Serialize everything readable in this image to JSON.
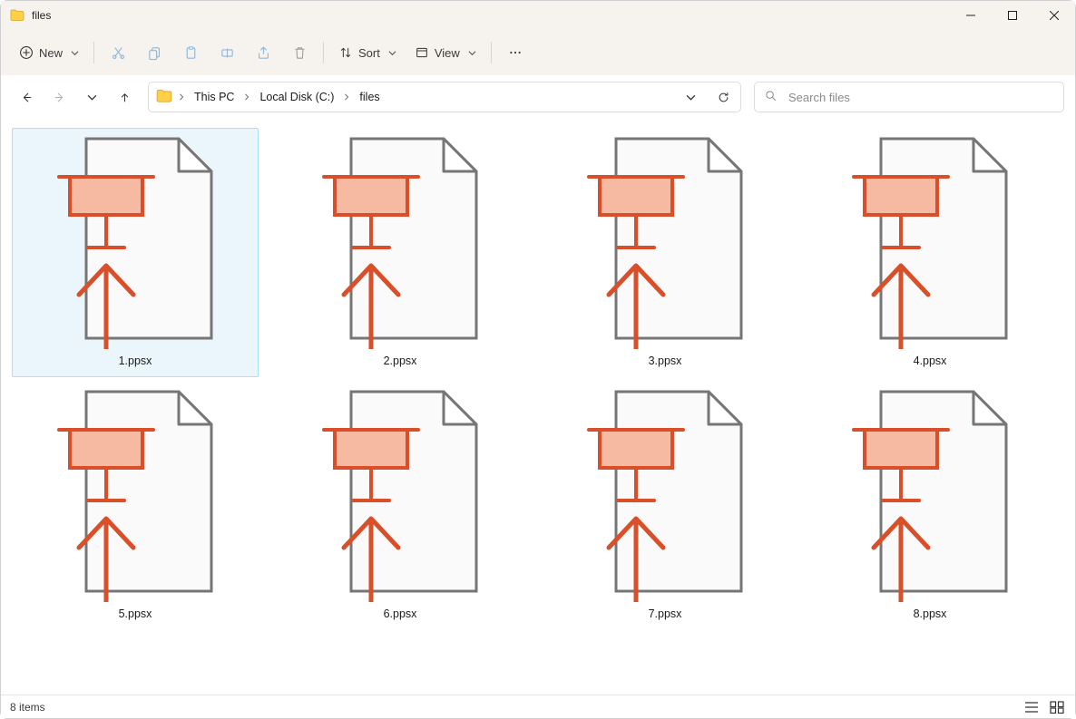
{
  "window": {
    "title": "files"
  },
  "toolbar": {
    "new_label": "New",
    "sort_label": "Sort",
    "view_label": "View"
  },
  "breadcrumbs": [
    {
      "label": "This PC"
    },
    {
      "label": "Local Disk (C:)"
    },
    {
      "label": "files"
    }
  ],
  "search": {
    "placeholder": "Search files"
  },
  "files": [
    {
      "name": "1.ppsx",
      "selected": true
    },
    {
      "name": "2.ppsx",
      "selected": false
    },
    {
      "name": "3.ppsx",
      "selected": false
    },
    {
      "name": "4.ppsx",
      "selected": false
    },
    {
      "name": "5.ppsx",
      "selected": false
    },
    {
      "name": "6.ppsx",
      "selected": false
    },
    {
      "name": "7.ppsx",
      "selected": false
    },
    {
      "name": "8.ppsx",
      "selected": false
    }
  ],
  "status": {
    "text": "8 items"
  },
  "colors": {
    "accent_orange_stroke": "#d94f2a",
    "accent_orange_fill": "#f6b9a1",
    "page_stroke": "#767676",
    "page_fill": "#fafafa",
    "selection_bg": "#eaf6fb",
    "selection_border": "#a8e1f7"
  }
}
